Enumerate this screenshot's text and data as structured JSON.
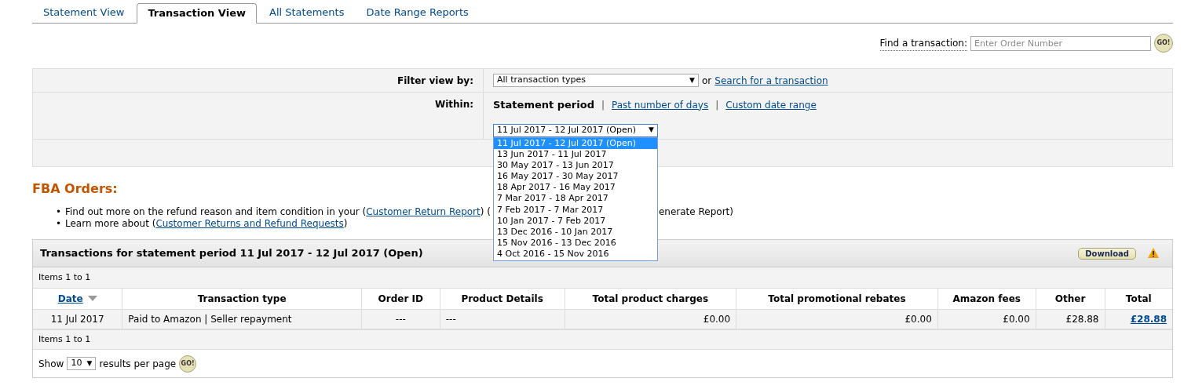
{
  "tabs": [
    {
      "label": "Statement View",
      "selected": false
    },
    {
      "label": "Transaction View",
      "selected": true
    },
    {
      "label": "All Statements",
      "selected": false
    },
    {
      "label": "Date Range Reports",
      "selected": false
    }
  ],
  "find": {
    "label": "Find a transaction:",
    "placeholder": "Enter Order Number",
    "button": "GO!"
  },
  "filter": {
    "label": "Filter view by:",
    "value": "All transaction types",
    "arrow": "▼",
    "or_text": "or",
    "link": "Search for a transaction"
  },
  "within": {
    "label": "Within:",
    "options": [
      {
        "label": "Statement period",
        "selected": true
      },
      {
        "label": "Past number of days",
        "selected": false,
        "separator": "|"
      },
      {
        "label": "Custom date range",
        "selected": false,
        "separator": "|"
      }
    ],
    "period_select": {
      "value": "11 Jul 2017 - 12 Jul 2017 (Open)",
      "arrow": "▼",
      "expanded": true,
      "options": [
        {
          "label": "11 Jul 2017 - 12 Jul 2017 (Open)",
          "selected": true
        },
        {
          "label": "13 Jun 2017 - 11 Jul 2017",
          "selected": false
        },
        {
          "label": "30 May 2017 - 13 Jun 2017",
          "selected": false
        },
        {
          "label": "16 May 2017 - 30 May 2017",
          "selected": false
        },
        {
          "label": "18 Apr 2017 - 16 May 2017",
          "selected": false
        },
        {
          "label": "7 Mar 2017 - 18 Apr 2017",
          "selected": false
        },
        {
          "label": "7 Feb 2017 - 7 Mar 2017",
          "selected": false
        },
        {
          "label": "10 Jan 2017 - 7 Feb 2017",
          "selected": false
        },
        {
          "label": "13 Dec 2016 - 10 Jan 2017",
          "selected": false
        },
        {
          "label": "15 Nov 2016 - 13 Dec 2016",
          "selected": false
        },
        {
          "label": "4 Oct 2016 - 15 Nov 2016",
          "selected": false
        }
      ]
    }
  },
  "fba": {
    "heading": "FBA Orders:",
    "bullets": [
      [
        {
          "kind": "marker",
          "text": "•"
        },
        {
          "kind": "text",
          "text": "Find out more on the refund reason and item condition in your ("
        },
        {
          "kind": "link",
          "text": "Customer Return Report"
        },
        {
          "kind": "text",
          "text": ") ("
        },
        {
          "kind": "covered"
        },
        {
          "kind": "text",
          "text": "enerate Report)"
        }
      ],
      [
        {
          "kind": "marker",
          "text": "•"
        },
        {
          "kind": "text",
          "text": "Learn more about ("
        },
        {
          "kind": "link",
          "text": "Customer Returns and Refund Requests"
        },
        {
          "kind": "text",
          "text": ")"
        }
      ]
    ]
  },
  "transactions": {
    "title": "Transactions for statement period 11 Jul 2017 - 12 Jul 2017 (Open)",
    "download": "Download",
    "items_top": "Items 1 to 1",
    "columns": [
      {
        "label": "Date",
        "sorted": true
      },
      {
        "label": "Transaction type",
        "sorted": false
      },
      {
        "label": "Order ID",
        "sorted": false
      },
      {
        "label": "Product Details",
        "sorted": false
      },
      {
        "label": "Total product charges",
        "sorted": false
      },
      {
        "label": "Total promotional rebates",
        "sorted": false
      },
      {
        "label": "Amazon fees",
        "sorted": false
      },
      {
        "label": "Other",
        "sorted": false
      },
      {
        "label": "Total",
        "sorted": false
      }
    ],
    "rows": [
      [
        "11 Jul 2017",
        "Paid to Amazon | Seller repayment",
        "---",
        "---",
        "£0.00",
        "£0.00",
        "£0.00",
        "£28.88",
        "£28.88"
      ]
    ],
    "items_bottom": "Items 1 to 1",
    "show_label": "Show",
    "per_page": "10",
    "per_page_arrow": "▼",
    "per_page_label": "results per page",
    "go": "GO!"
  }
}
